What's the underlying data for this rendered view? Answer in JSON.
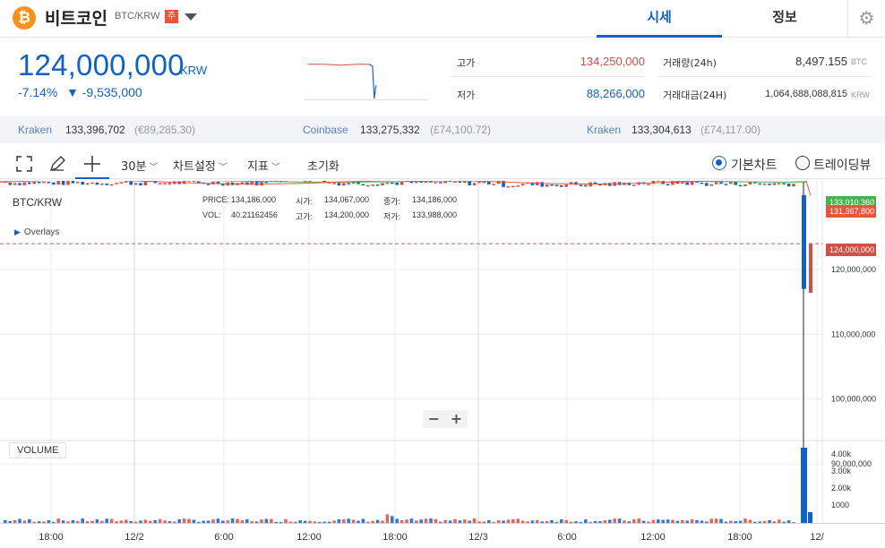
{
  "header": {
    "coin_symbol": "₿",
    "coin_name": "비트코인",
    "pair": "BTC/KRW",
    "warning_badge": "주",
    "tabs": [
      {
        "label": "시세",
        "active": true
      },
      {
        "label": "정보",
        "active": false
      }
    ],
    "settings_icon": "gear-icon"
  },
  "summary": {
    "price": "124,000,000",
    "unit": "KRW",
    "change_rate": "-7.14%",
    "change_amount": "▼ -9,535,000",
    "high_label": "고가",
    "high_value": "134,250,000",
    "low_label": "저가",
    "low_value": "88,266,000",
    "volume_label": "거래량(24h)",
    "volume_value": "8,497.155",
    "volume_unit": "BTC",
    "turnover_label": "거래대금(24H)",
    "turnover_value": "1,064,688,088,815",
    "turnover_unit": "KRW"
  },
  "exchanges": [
    {
      "name": "Kraken",
      "price": "133,396,702",
      "sub": "(€89,285.30)"
    },
    {
      "name": "Coinbase",
      "price": "133,275,332",
      "sub": "(£74,100.72)"
    },
    {
      "name": "Kraken",
      "price": "133,304,613",
      "sub": "(£74,117.00)"
    }
  ],
  "toolbar": {
    "interval": "30분",
    "chart_settings": "차트설정",
    "indicators": "지표",
    "reset": "초기화",
    "view_basic": "기본차트",
    "view_tradingview": "트레이딩뷰"
  },
  "chart": {
    "symbol": "BTC/KRW",
    "ohlc": {
      "price_label": "PRICE:",
      "price": "134,186,000",
      "open_label": "시가:",
      "open": "134,067,000",
      "close_label": "종가:",
      "close": "134,186,000",
      "vol_label": "VOL:",
      "vol": "40.21162456",
      "high_label": "고가:",
      "high": "134,200,000",
      "low_label": "저가:",
      "low": "133,988,000"
    },
    "overlays": "Overlays",
    "zoom_out": "−",
    "zoom_in": "+",
    "volume_title": "VOLUME",
    "price_tags": {
      "ma_green": "133,010,360",
      "ma_red": "131,367,800",
      "current": "124,000,000"
    },
    "colors": {
      "up": "#d24f45",
      "down": "#1261c4",
      "ma_green": "#4caf50",
      "ma_red": "#e8563a"
    }
  },
  "chart_data": {
    "type": "candlestick",
    "symbol": "BTC/KRW",
    "interval": "30분",
    "price_ticks": [
      120000000,
      110000000,
      100000000,
      90000000
    ],
    "price_tick_labels": [
      "120,000,000",
      "110,000,000",
      "100,000,000",
      "90,000,000"
    ],
    "volume_ticks": [
      4000,
      3000,
      2000,
      1000
    ],
    "volume_tick_labels": [
      "4.00k",
      "3.00k",
      "2.00k",
      "1000"
    ],
    "time_labels": [
      "18:00",
      "12/2",
      "6:00",
      "12:00",
      "18:00",
      "12/3",
      "6:00",
      "12:00",
      "18:00",
      "12/"
    ],
    "ylim": [
      87000000,
      137000000
    ],
    "current_price": 124000000,
    "grid": true
  }
}
